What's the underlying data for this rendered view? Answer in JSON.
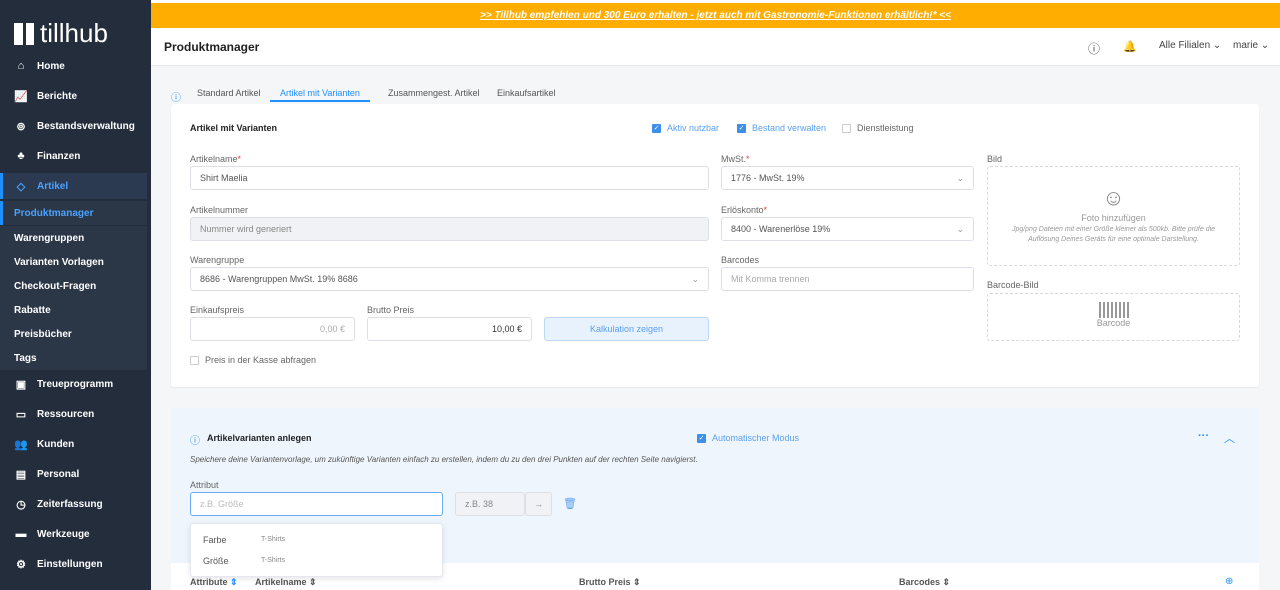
{
  "banner": {
    "text": ">> Tillhub empfehlen und 300 Euro erhalten - jetzt auch mit Gastronomie-Funktionen erhältlich!* <<"
  },
  "brand": {
    "name": "tillhub"
  },
  "sidebar": {
    "items": [
      {
        "label": "Home",
        "icon": "home-icon",
        "glyph": "⌂"
      },
      {
        "label": "Berichte",
        "icon": "chart-icon",
        "glyph": "📈"
      },
      {
        "label": "Bestandsverwaltung",
        "icon": "inventory-icon",
        "glyph": "⊚"
      },
      {
        "label": "Finanzen",
        "icon": "piggy-bank-icon",
        "glyph": "♣"
      },
      {
        "label": "Artikel",
        "icon": "tag-icon",
        "glyph": "◇"
      }
    ],
    "subitems": [
      "Produktmanager",
      "Warengruppen",
      "Varianten Vorlagen",
      "Checkout-Fragen",
      "Rabatte",
      "Preisbücher",
      "Tags"
    ],
    "items2": [
      {
        "label": "Treueprogramm",
        "icon": "gift-icon",
        "glyph": "▣"
      },
      {
        "label": "Ressourcen",
        "icon": "monitor-icon",
        "glyph": "▭"
      },
      {
        "label": "Kunden",
        "icon": "users-icon",
        "glyph": "👥"
      },
      {
        "label": "Personal",
        "icon": "id-card-icon",
        "glyph": "▤"
      },
      {
        "label": "Zeiterfassung",
        "icon": "clock-icon",
        "glyph": "◷"
      },
      {
        "label": "Werkzeuge",
        "icon": "folder-icon",
        "glyph": "▬"
      },
      {
        "label": "Einstellungen",
        "icon": "gear-icon",
        "glyph": "⚙"
      }
    ]
  },
  "header": {
    "title": "Produktmanager",
    "branch": "Alle Filialen",
    "user": "marie"
  },
  "tabs": [
    "Standard Artikel",
    "Artikel mit Varianten",
    "Zusammengest. Artikel",
    "Einkaufsartikel"
  ],
  "form": {
    "title": "Artikel mit Varianten",
    "checks": [
      {
        "label": "Aktiv nutzbar",
        "checked": true
      },
      {
        "label": "Bestand verwalten",
        "checked": true
      },
      {
        "label": "Dienstleistung",
        "checked": false
      }
    ],
    "name_label": "Artikelname",
    "name_value": "Shirt Maelia",
    "vat_label": "MwSt.",
    "vat_value": "1776 - MwSt. 19%",
    "number_label": "Artikelnummer",
    "number_value": "Nummer wird generiert",
    "revenue_label": "Erlöskonto",
    "revenue_value": "8400 - Warenerlöse 19%",
    "group_label": "Warengruppe",
    "group_value": "8686 - Warengruppen MwSt. 19% 8686",
    "barcodes_label": "Barcodes",
    "barcodes_placeholder": "Mit Komma trennen",
    "purchase_label": "Einkaufspreis",
    "purchase_value": "0,00 €",
    "gross_label": "Brutto Preis",
    "gross_value": "10,00 €",
    "calc_button": "Kalkulation zeigen",
    "ask_price": "Preis in der Kasse abfragen",
    "image_label": "Bild",
    "image_add": "Foto hinzufügen",
    "image_hint": "Jpg/png Dateien mit einer Größe kleiner als 500kb. Bitte prüfe die Auflösung Deines Geräts für eine optimale Darstellung.",
    "barcode_image_label": "Barcode-Bild",
    "barcode_text": "Barcode"
  },
  "variants": {
    "title": "Artikelvarianten anlegen",
    "auto_mode": "Automatischer Modus",
    "hint": "Speichere deine Variantenvorlage, um zukünftige Varianten einfach zu erstellen, indem du zu den drei Punkten auf der rechten Seite navigierst.",
    "attr_label": "Attribut",
    "attr_placeholder": "z.B. Größe",
    "value_placeholder": "z.B. 38",
    "suggestions": [
      {
        "name": "Farbe",
        "group": "T-Shirts"
      },
      {
        "name": "Größe",
        "group": "T-Shirts"
      }
    ],
    "columns": [
      "Attribute",
      "Artikelname",
      "Brutto Preis",
      "Barcodes"
    ]
  }
}
